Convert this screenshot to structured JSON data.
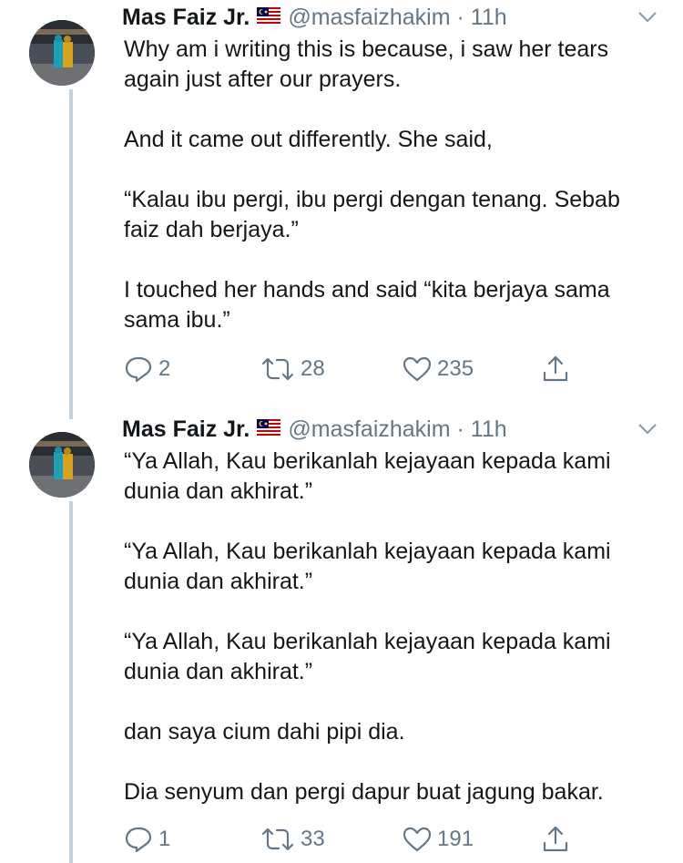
{
  "tweets": [
    {
      "name": "Mas Faiz Jr.",
      "handle": "@masfaizhakim",
      "dot": "·",
      "time": "11h",
      "paragraphs": [
        "Why am i writing this is because, i saw her tears again just after our prayers.",
        "And it came out differently. She said,",
        "“Kalau ibu pergi, ibu pergi dengan tenang. Sebab faiz dah berjaya.”",
        "I touched her hands and said “kita berjaya sama sama ibu.”"
      ],
      "replies": "2",
      "retweets": "28",
      "likes": "235"
    },
    {
      "name": "Mas Faiz Jr.",
      "handle": "@masfaizhakim",
      "dot": "·",
      "time": "11h",
      "paragraphs": [
        "“Ya Allah, Kau berikanlah kejayaan kepada kami dunia dan akhirat.”",
        "“Ya Allah, Kau berikanlah kejayaan kepada kami dunia dan akhirat.”",
        "“Ya Allah, Kau berikanlah kejayaan kepada kami dunia dan akhirat.”",
        "dan saya cium dahi pipi dia.",
        "Dia senyum dan pergi dapur buat jagung bakar."
      ],
      "replies": "1",
      "retweets": "33",
      "likes": "191"
    }
  ],
  "icons": {
    "flag": "malaysia-flag-icon",
    "caret": "chevron-down-icon",
    "reply": "reply-icon",
    "retweet": "retweet-icon",
    "like": "heart-icon",
    "share": "share-icon"
  },
  "colors": {
    "text": "#14171a",
    "muted": "#657786",
    "thread_line": "#c6d0d8"
  }
}
